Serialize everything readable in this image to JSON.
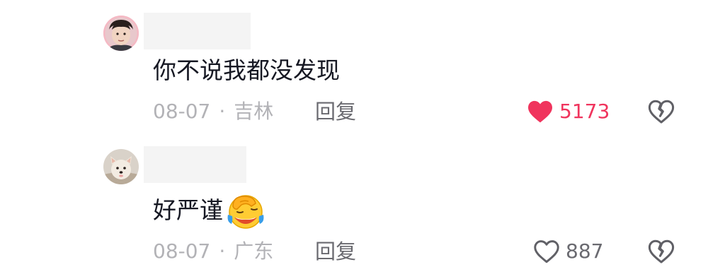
{
  "comments": [
    {
      "text": "你不说我都没发现",
      "date": "08-07",
      "separator": "·",
      "location": "吉林",
      "reply_label": "回复",
      "likes": "5173",
      "liked": true
    },
    {
      "text": "好严谨",
      "date": "08-07",
      "separator": "·",
      "location": "广东",
      "reply_label": "回复",
      "likes": "887",
      "liked": false,
      "emoji": "face-palm-crying-laughing"
    }
  ],
  "colors": {
    "liked": "#f0345d",
    "meta": "#b2b2b6",
    "text": "#161823",
    "icon": "#606066"
  }
}
